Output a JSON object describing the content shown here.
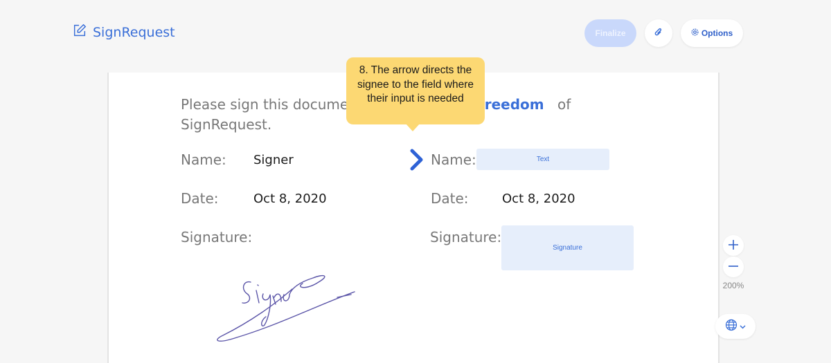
{
  "header": {
    "logo_text": "SignRequest",
    "logo_icon": "pen-square-icon",
    "finalize_label": "Finalize",
    "attach_icon": "paperclip-icon",
    "options_label": "Options",
    "options_icon": "gear-icon"
  },
  "document": {
    "intro_line1": "Please sign this documen",
    "intro_freedom": "freedom",
    "intro_of": "of",
    "intro_line2": "SignRequest.",
    "left": {
      "name_label": "Name:",
      "name_value": "Signer",
      "date_label": "Date:",
      "date_value": "Oct 8, 2020",
      "signature_label": "Signature:",
      "signature_image": "handwritten-signature"
    },
    "right": {
      "name_label": "Name:",
      "name_field_placeholder": "Text",
      "date_label": "Date:",
      "date_value": "Oct 8, 2020",
      "signature_label": "Signature:",
      "signature_field_placeholder": "Signature"
    },
    "arrow_icon": "chevron-right-icon"
  },
  "tooltip": {
    "text": "8. The arrow directs the signee to the field where their input is needed"
  },
  "zoom": {
    "zoom_in_icon": "plus-icon",
    "zoom_out_icon": "minus-icon",
    "level": "200%"
  },
  "language": {
    "icon": "globe-icon",
    "dropdown_icon": "chevron-down-icon"
  },
  "colors": {
    "accent": "#3a6fd8",
    "tooltip_bg": "#fcd873",
    "field_bg": "#e6eefb",
    "finalize_disabled": "#c9d8fb"
  }
}
